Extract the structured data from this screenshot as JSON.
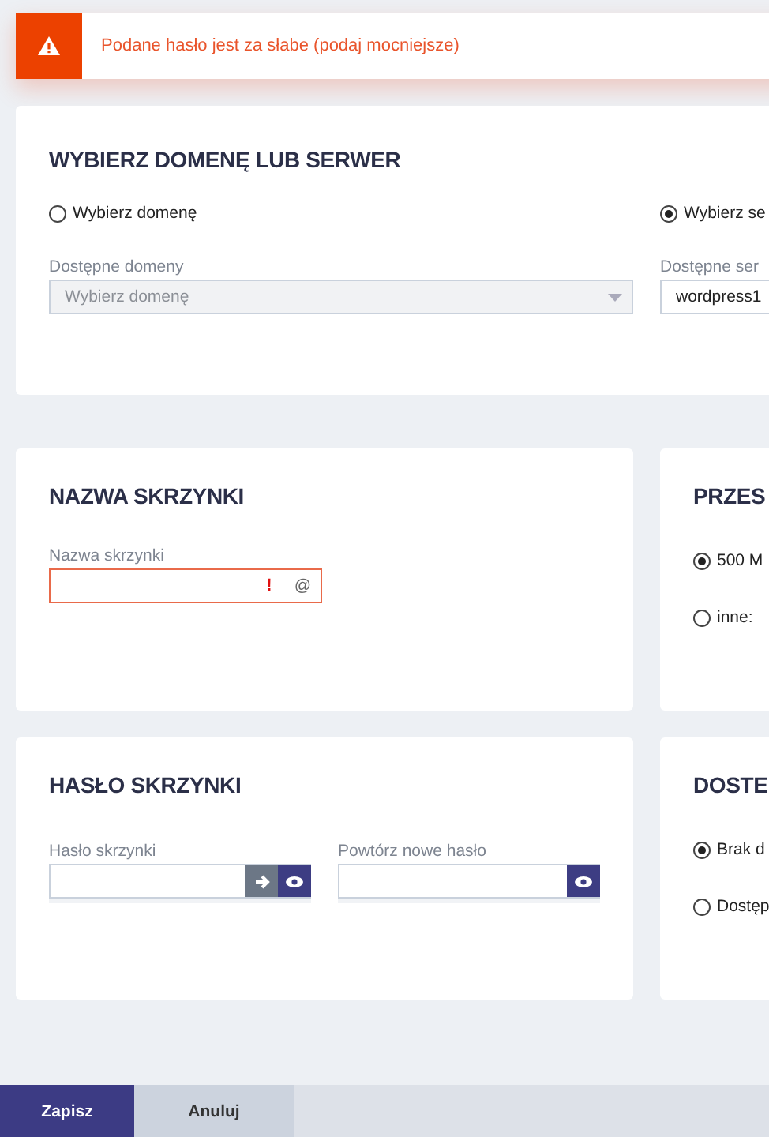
{
  "alert": {
    "text": "Podane hasło jest za słabe (podaj mocniejsze)"
  },
  "domain_card": {
    "title": "WYBIERZ DOMENĘ LUB SERWER",
    "columns": [
      {
        "option": {
          "label": "Wybierz domenę",
          "selected": false
        },
        "field": {
          "label": "Dostępne domeny",
          "value": "Wybierz domenę",
          "disabled": true
        }
      },
      {
        "option": {
          "label": "Wybierz se",
          "selected": true
        },
        "field": {
          "label": "Dostępne ser",
          "value": "wordpress1",
          "disabled": false
        }
      }
    ]
  },
  "name_card": {
    "title": "NAZWA SKRZYNKI",
    "field": {
      "label": "Nazwa skrzynki",
      "error": true,
      "error_mark": "!",
      "suffix": "@"
    }
  },
  "size_card": {
    "title": "PRZES",
    "options": [
      {
        "label": "500 M",
        "selected": true
      },
      {
        "label": "inne:",
        "selected": false
      }
    ]
  },
  "password_card": {
    "title": "HASŁO SKRZYNKI",
    "fields": [
      {
        "label": "Hasło skrzynki",
        "generate_button": true
      },
      {
        "label": "Powtórz nowe hasło",
        "generate_button": false
      }
    ]
  },
  "access_card": {
    "title": "DOSTE",
    "options": [
      {
        "label": "Brak d",
        "selected": true
      },
      {
        "label": "Dostęp",
        "selected": false
      }
    ]
  },
  "footer": {
    "buttons": [
      {
        "label": "Zapisz",
        "kind": "primary"
      },
      {
        "label": "Anuluj",
        "kind": "secondary"
      }
    ]
  }
}
